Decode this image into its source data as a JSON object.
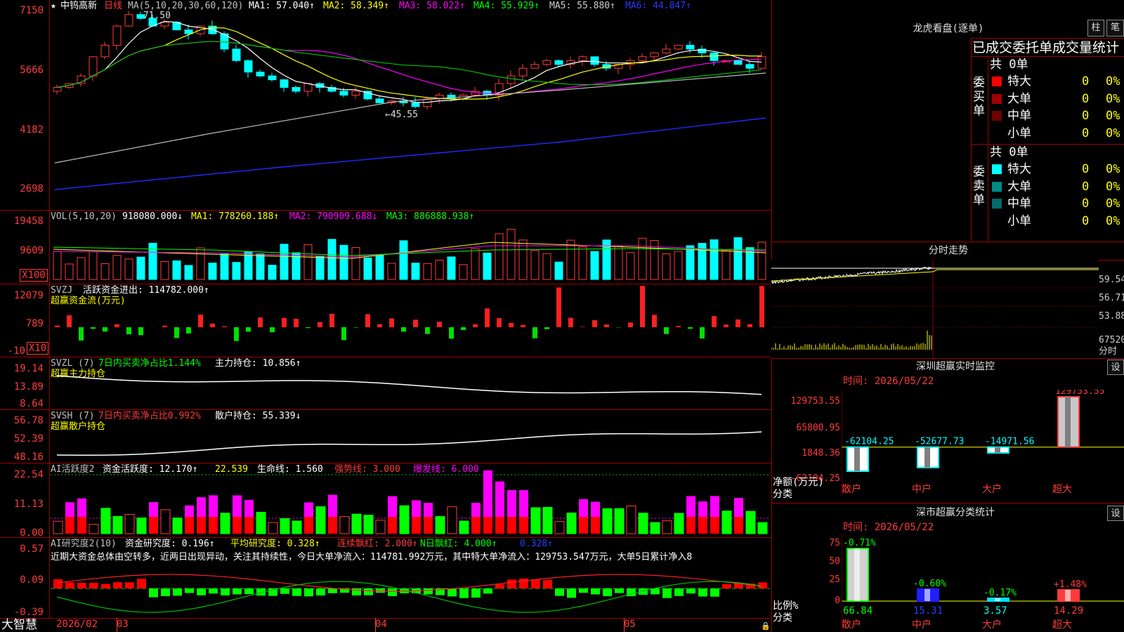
{
  "app": {
    "brand": "大智慧"
  },
  "main_chart": {
    "star_icon": "star-icon",
    "stock_name": "中钨高新",
    "period": "日线",
    "ma_label": "MA(5,10,20,30,60,120)",
    "ma1": "MA1: 57.040↑",
    "ma2": "MA2: 58.349↑",
    "ma3": "MA3: 58.022↑",
    "ma4": "MA4: 55.929↑",
    "ma5": "MA5: 55.880↑",
    "ma6": "MA6: 44.847↑",
    "y_ticks": [
      "7150",
      "5666",
      "4182",
      "2698"
    ],
    "high_label": "71.50",
    "low_label": "45.55"
  },
  "vol_panel": {
    "label": "VOL(5,10,20)",
    "vol": "918080.000↓",
    "ma1": "MA1: 778260.188↑",
    "ma2": "MA2: 790909.688↓",
    "ma3": "MA3: 886888.938↑",
    "y_ticks": [
      "19458",
      "9609"
    ],
    "unit": "X100"
  },
  "svzj_panel": {
    "label": "SVZJ",
    "active_flow": "活跃资金进出: 114782.000↑",
    "sub": "超赢资金流(万元)",
    "y_ticks": [
      "12079",
      "789",
      "-10"
    ],
    "unit": "X10"
  },
  "svzl_panel": {
    "label": "SVZL (7)",
    "ratio": "7日内买卖净占比1.144%",
    "holding": "主力持仓: 10.856↑",
    "sub": "超赢主力持仓",
    "y_ticks": [
      "19.14",
      "13.89",
      "8.64"
    ]
  },
  "svsh_panel": {
    "label": "SVSH (7)",
    "ratio": "7日内买卖净占比0.992%",
    "holding": "散户持仓: 55.339↓",
    "sub": "超赢散户持仓",
    "y_ticks": [
      "56.78",
      "52.39",
      "48.16"
    ]
  },
  "ai_active": {
    "label": "AI活跃度2",
    "active": "资金活跃度: 12.170↑",
    "v2": "22.539",
    "life": "生命线: 1.560",
    "strong": "强势线: 3.000",
    "burst": "爆发线: 6.000",
    "y_ticks": [
      "22.54",
      "11.13",
      "0.00"
    ]
  },
  "ai_research": {
    "label": "AI研究度2(10)",
    "research": "资金研究度: 0.196↑",
    "avg": "平均研究度: 0.328↑",
    "red_days": "连续飘红: 2.000↑",
    "n_red": "N日飘红: 4.000↑",
    "v": "0.328↑",
    "commentary": "近期大资金总体由空转多，近两日出现异动，关注其持续性，今日大单净流入：114781.992万元，其中特大单净流入：129753.547万元，大单5日累计净入8",
    "y_ticks": [
      "0.57",
      "0.09",
      "-0.39"
    ]
  },
  "x_axis": {
    "labels": [
      "2026/02",
      "03",
      "04",
      "05"
    ]
  },
  "dragon_tiger": {
    "title": "龙虎看盘(逐单)",
    "btn_bar": "柱",
    "btn_pen": "笔",
    "header": "已成交委托单成交量统计",
    "buy_side": "委买单",
    "sell_side": "委卖单",
    "buy_total": "共 0单",
    "sell_total": "共 0单",
    "buy_rows": [
      {
        "name": "特大",
        "count": "0",
        "pct": "0%",
        "color": "#ff0000"
      },
      {
        "name": "大单",
        "count": "0",
        "pct": "0%",
        "color": "#a00000"
      },
      {
        "name": "中单",
        "count": "0",
        "pct": "0%",
        "color": "#700000"
      },
      {
        "name": "小单",
        "count": "0",
        "pct": "0%",
        "color": "#000000"
      }
    ],
    "sell_rows": [
      {
        "name": "特大",
        "count": "0",
        "pct": "0%",
        "color": "#00ffff"
      },
      {
        "name": "大单",
        "count": "0",
        "pct": "0%",
        "color": "#008a8a"
      },
      {
        "name": "中单",
        "count": "0",
        "pct": "0%",
        "color": "#006a6a"
      },
      {
        "name": "小单",
        "count": "0",
        "pct": "0%",
        "color": "#000000"
      }
    ]
  },
  "intraday": {
    "title": "分时走势",
    "y_ticks": [
      "59.54",
      "56.71",
      "53.88"
    ],
    "vol_tick": "67520",
    "vol_label": "分时"
  },
  "sz_monitor": {
    "title": "深圳超赢实时监控",
    "btn": "设",
    "time": "时间: 2026/05/22",
    "y_ticks": [
      "129753.55",
      "65800.95",
      "1848.36",
      "-62104.25"
    ],
    "net_label": "净额(万元)",
    "cat_label": "分类",
    "categories": [
      "散户",
      "中户",
      "大户",
      "超大"
    ],
    "chart_data": {
      "type": "bar",
      "categories": [
        "散户",
        "中户",
        "大户",
        "超大"
      ],
      "values": [
        -62104.25,
        -52677.73,
        -14971.56,
        129753.55
      ],
      "value_labels": [
        "-62104.25",
        "-52677.73",
        "-14971.56",
        "129753.55"
      ],
      "ylim": [
        -62104.25,
        129753.55
      ]
    }
  },
  "sz_class": {
    "title": "深市超赢分类统计",
    "btn": "设",
    "time": "时间: 2026/05/22",
    "y_ticks": [
      "75",
      "50",
      "25",
      "0"
    ],
    "ratio_label": "比例%",
    "cat_label": "分类",
    "categories": [
      "散户",
      "中户",
      "大户",
      "超大"
    ],
    "chart_data": {
      "type": "bar",
      "categories": [
        "散户",
        "中户",
        "大户",
        "超大"
      ],
      "values": [
        66.84,
        15.31,
        3.57,
        14.29
      ],
      "value_labels": [
        "66.84",
        "15.31",
        "3.57",
        "14.29"
      ],
      "change_labels": [
        "-0.71%",
        "-0.60%",
        "-0.17%",
        "+1.48%"
      ],
      "ylim": [
        0,
        75
      ]
    }
  }
}
